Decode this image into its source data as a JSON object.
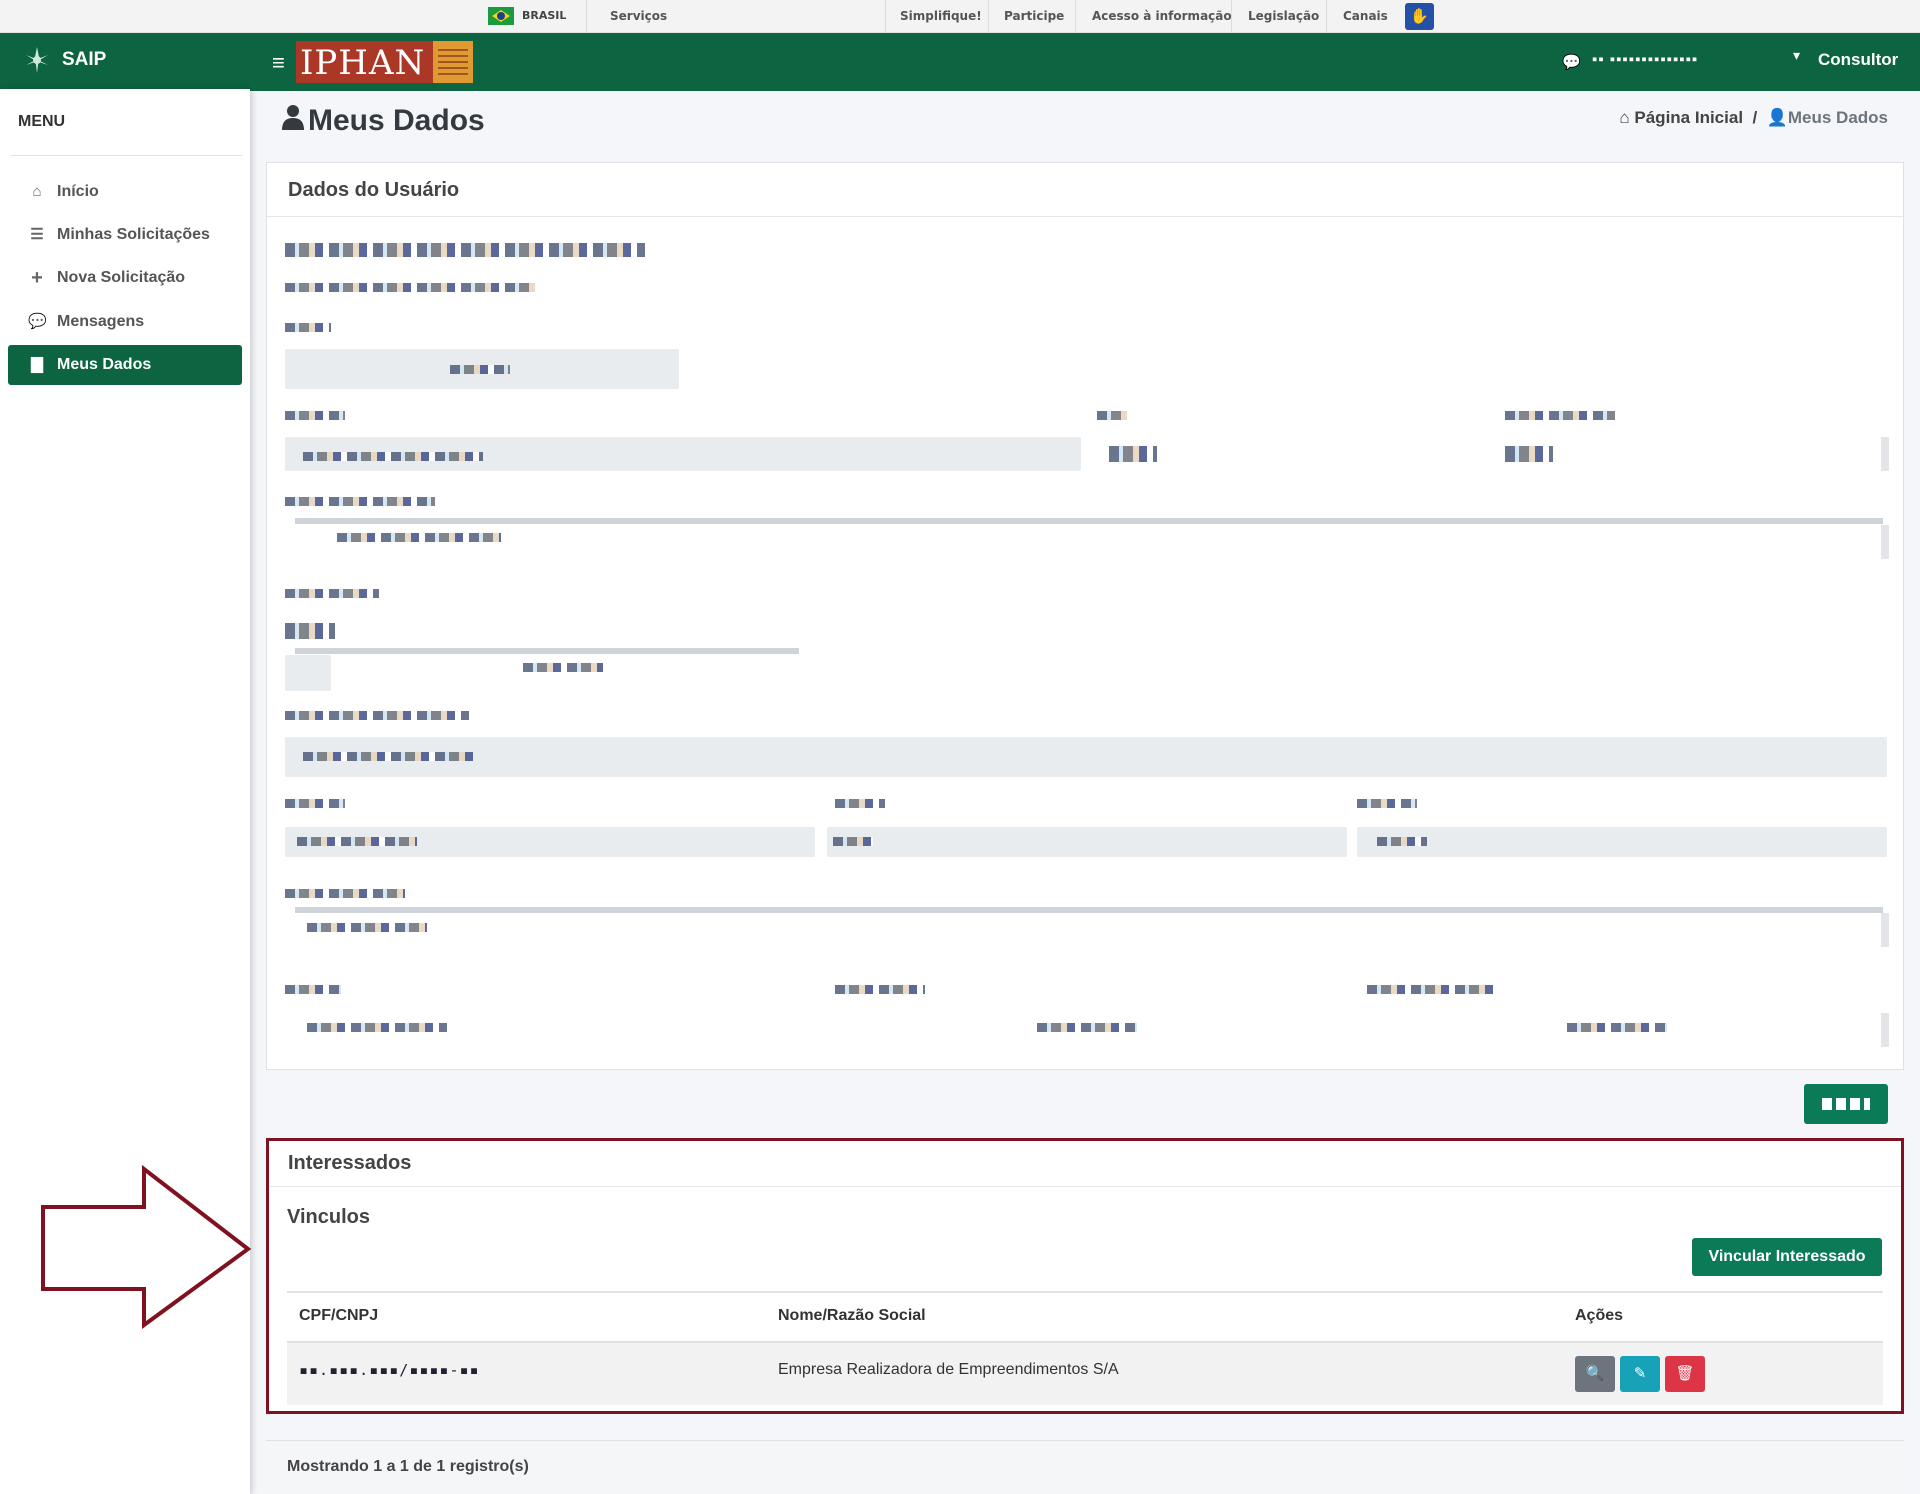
{
  "gov_bar": {
    "country": "BRASIL",
    "services": "Serviços",
    "links": [
      "Simplifique!",
      "Participe",
      "Acesso à informação",
      "Legislação",
      "Canais"
    ],
    "accessibility_icon": "hand-accessibility-icon"
  },
  "brand": {
    "name": "SAIP"
  },
  "sidebar": {
    "title": "MENU",
    "items": [
      {
        "label": "Início",
        "icon": "home-icon"
      },
      {
        "label": "Minhas Solicitações",
        "icon": "list-icon"
      },
      {
        "label": "Nova Solicitação",
        "icon": "plus-icon"
      },
      {
        "label": "Mensagens",
        "icon": "comments-icon"
      },
      {
        "label": "Meus Dados",
        "icon": "file-icon",
        "active": true
      }
    ]
  },
  "header": {
    "logo_text": "IPHAN",
    "user_name": "▪▪ ▪▪▪▪▪▪▪▪▪▪▪▪▪▪",
    "role": "Consultor"
  },
  "page": {
    "title": "Meus Dados",
    "breadcrumb": [
      "Página Inicial",
      "Meus Dados"
    ]
  },
  "dados_card": {
    "title": "Dados do Usuário"
  },
  "interessados": {
    "title": "Interessados",
    "subtitle": "Vinculos",
    "link_button": "Vincular Interessado",
    "columns": [
      "CPF/CNPJ",
      "Nome/Razão Social",
      "Ações"
    ],
    "rows": [
      {
        "cpf_cnpj": "▪▪.▪▪▪.▪▪▪/▪▪▪▪-▪▪",
        "nome": "Empresa Realizadora de Empreendimentos S/A"
      }
    ]
  },
  "footer": {
    "records_info": "Mostrando 1 a 1 de 1 registro(s)"
  },
  "colors": {
    "primary_green": "#0d6441",
    "button_green": "#0a7a57",
    "highlight": "#7e1220",
    "info": "#17a2b8",
    "danger": "#dc3545"
  }
}
